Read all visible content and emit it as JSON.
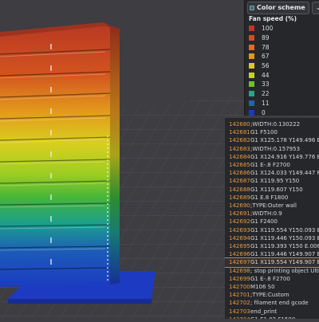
{
  "legend": {
    "title": "Color scheme",
    "subtitle": "Fan speed (%)",
    "items": [
      {
        "label": "100",
        "color": "#c73320"
      },
      {
        "label": "89",
        "color": "#d9491f"
      },
      {
        "label": "78",
        "color": "#e36a1f"
      },
      {
        "label": "67",
        "color": "#e9941a"
      },
      {
        "label": "56",
        "color": "#e6c421"
      },
      {
        "label": "44",
        "color": "#c9d41e"
      },
      {
        "label": "33",
        "color": "#6fc22a"
      },
      {
        "label": "22",
        "color": "#24a889"
      },
      {
        "label": "11",
        "color": "#1f62b5"
      },
      {
        "label": "0",
        "color": "#1b3bbd"
      }
    ]
  },
  "gcode": {
    "lines": [
      {
        "num": "142680",
        "text": ";WIDTH:0.130222"
      },
      {
        "num": "142681",
        "text": "G1 F5100"
      },
      {
        "num": "142682",
        "text": "G1 X125.178 Y149.496 E.00"
      },
      {
        "num": "142683",
        "text": ";WIDTH:0.157953"
      },
      {
        "num": "142684",
        "text": "G1 X124.916 Y149.776 E.00"
      },
      {
        "num": "142685",
        "text": "G1 E-.8 F2700"
      },
      {
        "num": "142686",
        "text": "G1 X124.033 Y149.447 F12"
      },
      {
        "num": "142687",
        "text": "G1 X119.95 Y150"
      },
      {
        "num": "142688",
        "text": "G1 X119.607 Y150"
      },
      {
        "num": "142689",
        "text": "G1 E.8 F1800"
      },
      {
        "num": "142690",
        "text": ";TYPE:Outer wall"
      },
      {
        "num": "142691",
        "text": ";WIDTH:0.9"
      },
      {
        "num": "142692",
        "text": "G1 F2400"
      },
      {
        "num": "142693",
        "text": "G1 X119.554 Y150.093 E.00"
      },
      {
        "num": "142694",
        "text": "G1 X119.446 Y150.093 E.00"
      },
      {
        "num": "142695",
        "text": "G1 X119.393 Y150 E.00687"
      },
      {
        "num": "142696",
        "text": "G1 X119.446 Y149.907 E.00"
      },
      {
        "num": "142697",
        "text": "G1 X119.554 Y149.907 E.00"
      },
      {
        "num": "142698",
        "text": "; stop printing object Ultimu"
      },
      {
        "num": "142699",
        "text": "G1 E-.8 F2700"
      },
      {
        "num": "142700",
        "text": "M106 S0"
      },
      {
        "num": "142701",
        "text": ";TYPE:Custom"
      },
      {
        "num": "142702",
        "text": "; filament end gcode"
      },
      {
        "num": "142703",
        "text": "end_print"
      },
      {
        "num": "142704",
        "text": "G1 E1.02 F1500"
      }
    ],
    "current_index": 17
  }
}
